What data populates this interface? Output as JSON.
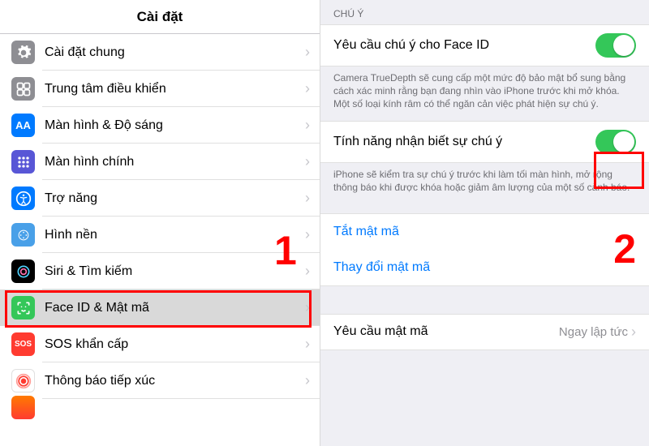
{
  "left": {
    "title": "Cài đặt",
    "items": [
      {
        "label": "Cài đặt chung"
      },
      {
        "label": "Trung tâm điều khiển"
      },
      {
        "label": "Màn hình & Độ sáng"
      },
      {
        "label": "Màn hình chính"
      },
      {
        "label": "Trợ năng"
      },
      {
        "label": "Hình nền"
      },
      {
        "label": "Siri & Tìm kiếm"
      },
      {
        "label": "Face ID & Mật mã"
      },
      {
        "label": "SOS khẩn cấp"
      },
      {
        "label": "Thông báo tiếp xúc"
      }
    ]
  },
  "right": {
    "section_header": "Chú ý",
    "attention_faceid_label": "Yêu cầu chú ý cho Face ID",
    "attention_faceid_footer": "Camera TrueDepth sẽ cung cấp một mức độ bảo mật bổ sung bằng cách xác minh rằng bạn đang nhìn vào iPhone trước khi mở khóa. Một số loại kính râm có thể ngăn cản việc phát hiện sự chú ý.",
    "attention_aware_label": "Tính năng nhận biết sự chú ý",
    "attention_aware_footer": "iPhone sẽ kiểm tra sự chú ý trước khi làm tối màn hình, mở rộng thông báo khi được khóa hoặc giảm âm lượng của một số cảnh báo.",
    "turn_off_passcode": "Tắt mật mã",
    "change_passcode": "Thay đổi mật mã",
    "require_passcode_label": "Yêu cầu mật mã",
    "require_passcode_value": "Ngay lập tức"
  },
  "annotations": {
    "num1": "1",
    "num2": "2"
  }
}
